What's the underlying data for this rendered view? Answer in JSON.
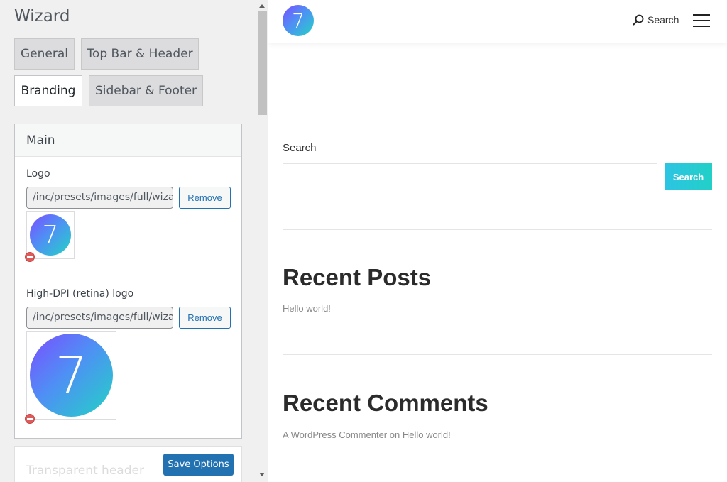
{
  "wizard": {
    "title": "Wizard",
    "tabs": [
      {
        "label": "General",
        "active": false
      },
      {
        "label": "Top Bar & Header",
        "active": false
      },
      {
        "label": "Branding",
        "active": true
      },
      {
        "label": "Sidebar & Footer",
        "active": false
      }
    ],
    "main_panel": {
      "title": "Main",
      "logo": {
        "label": "Logo",
        "path": "/inc/presets/images/full/wizard-logo.png",
        "remove_label": "Remove",
        "preview_glyph": "7"
      },
      "retina_logo": {
        "label": "High-DPI (retina) logo",
        "path": "/inc/presets/images/full/wizard-logo-hd.png",
        "remove_label": "Remove",
        "preview_glyph": "7"
      }
    },
    "transparent_panel": {
      "title": "Transparent header"
    },
    "save_label": "Save Options"
  },
  "preview": {
    "logo_glyph": "7",
    "header_search_label": "Search",
    "search_widget": {
      "title": "Search",
      "button_label": "Search"
    },
    "recent_posts": {
      "title": "Recent Posts",
      "items": [
        "Hello world!"
      ]
    },
    "recent_comments": {
      "title": "Recent Comments",
      "items": [
        {
          "author": "A WordPress Commenter",
          "connector": " on ",
          "post": "Hello world!"
        }
      ]
    }
  },
  "colors": {
    "accent_blue": "#2271b1",
    "logo_gradient": [
      "#7b4dff",
      "#4f8ff5",
      "#22d3c5"
    ],
    "search_button": "#2cc4e4",
    "delete_icon": "#dc5b5b"
  },
  "icons": [
    "search-icon",
    "menu-icon",
    "remove-image-icon"
  ]
}
